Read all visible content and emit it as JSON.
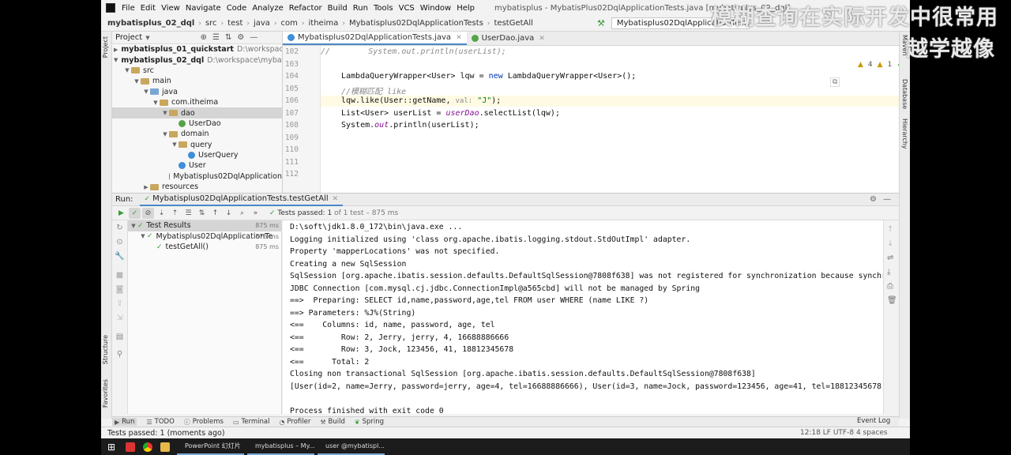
{
  "menubar": {
    "items": [
      "File",
      "Edit",
      "View",
      "Navigate",
      "Code",
      "Analyze",
      "Refactor",
      "Build",
      "Run",
      "Tools",
      "VCS",
      "Window",
      "Help"
    ],
    "window_title": "mybatisplus - MybatisPlus02DqlApplicationTests.java [mybatisplus_02_dql]"
  },
  "breadcrumb": {
    "items": [
      "mybatisplus_02_dql",
      "src",
      "test",
      "java",
      "com",
      "itheima",
      "Mybatisplus02DqlApplicationTests",
      "testGetAll"
    ],
    "run_config": "Mybatisplus02DqlApplicationTests.testGetAll"
  },
  "project_panel": {
    "title": "Project",
    "tree": [
      {
        "label": "mybatisplus_01_quickstart",
        "path": "D:\\workspace\\m",
        "bold": true,
        "kind": "module"
      },
      {
        "label": "mybatisplus_02_dql",
        "path": "D:\\workspace\\mybatisp",
        "bold": true,
        "kind": "module"
      },
      {
        "label": "src",
        "kind": "folder"
      },
      {
        "label": "main",
        "kind": "folder"
      },
      {
        "label": "java",
        "kind": "folder-blue"
      },
      {
        "label": "com.itheima",
        "kind": "folder"
      },
      {
        "label": "dao",
        "kind": "folder",
        "selected": true
      },
      {
        "label": "UserDao",
        "kind": "interface"
      },
      {
        "label": "domain",
        "kind": "folder"
      },
      {
        "label": "query",
        "kind": "folder"
      },
      {
        "label": "UserQuery",
        "kind": "class"
      },
      {
        "label": "User",
        "kind": "class"
      },
      {
        "label": "Mybatisplus02DqlApplication",
        "kind": "class"
      },
      {
        "label": "resources",
        "kind": "folder"
      }
    ]
  },
  "editor": {
    "tabs": [
      {
        "label": "Mybatisplus02DqlApplicationTests.java",
        "active": true
      },
      {
        "label": "UserDao.java",
        "active": false
      }
    ],
    "line_numbers": [
      "102",
      "103",
      "104",
      "105",
      "106",
      "107",
      "108",
      "109",
      "110",
      "111",
      "112"
    ],
    "lines": {
      "l102_comment": "//        System.out.println(userList);",
      "l104_a": "LambdaQueryWrapper<User> lqw = ",
      "l104_kw": "new",
      "l104_b": " LambdaQueryWrapper<User>();",
      "l105_comment": "//模糊匹配 like",
      "l106_a": "lqw.like(User::getName, ",
      "l106_hint": "val:",
      "l106_str": " \"J\"",
      "l106_b": ");",
      "l107_a": "List<User> userList = ",
      "l107_field": "userDao",
      "l107_b": ".selectList(lqw);",
      "l108_a": "System.",
      "l108_field": "out",
      "l108_b": ".println(userList);"
    },
    "inspections": {
      "warnings": "4",
      "weak_warnings": "1",
      "ok": "1"
    }
  },
  "run_panel": {
    "label": "Run:",
    "tab": "Mybatisplus02DqlApplicationTests.testGetAll",
    "status_main": "Tests passed:",
    "status_count": "1",
    "status_rest": "of 1 test – 875 ms",
    "results": [
      {
        "label": "Test Results",
        "time": "875 ms"
      },
      {
        "label": "Mybatisplus02DqlApplicationTe",
        "time": "875 ms"
      },
      {
        "label": "testGetAll()",
        "time": "875 ms"
      }
    ],
    "console": [
      "D:\\soft\\jdk1.8.0_172\\bin\\java.exe ...",
      "Logging initialized using 'class org.apache.ibatis.logging.stdout.StdOutImpl' adapter.",
      "Property 'mapperLocations' was not specified.",
      "Creating a new SqlSession",
      "SqlSession [org.apache.ibatis.session.defaults.DefaultSqlSession@7808f638] was not registered for synchronization because synchr",
      "JDBC Connection [com.mysql.cj.jdbc.ConnectionImpl@a565cbd] will not be managed by Spring",
      "==>  Preparing: SELECT id,name,password,age,tel FROM user WHERE (name LIKE ?)",
      "==> Parameters: %J%(String)",
      "<==    Columns: id, name, password, age, tel",
      "<==        Row: 2, Jerry, jerry, 4, 16688886666",
      "<==        Row: 3, Jock, 123456, 41, 18812345678",
      "<==      Total: 2",
      "Closing non transactional SqlSession [org.apache.ibatis.session.defaults.DefaultSqlSession@7808f638]",
      "[User(id=2, name=Jerry, password=jerry, age=4, tel=16688886666), User(id=3, name=Jock, password=123456, age=41, tel=18812345678)",
      "",
      "Process finished with exit code 0"
    ]
  },
  "side_tabs": {
    "left": [
      "Project",
      "Structure",
      "Favorites"
    ],
    "right": [
      "Maven",
      "Database",
      "Hierarchy"
    ]
  },
  "bottom_tabs": [
    "Run",
    "TODO",
    "Problems",
    "Terminal",
    "Profiler",
    "Build",
    "Spring"
  ],
  "event_log": "Event Log",
  "status_bar": {
    "text": "Tests passed: 1 (moments ago)",
    "right": "12:18   LF   UTF-8   4 spaces"
  },
  "overlay": {
    "line1": "模糊查询在实际开发中很常用",
    "line2": "越学越像"
  },
  "taskbar": {
    "tasks": [
      "PowerPoint 幻灯片",
      "mybatisplus – My...",
      "user @mybatispl..."
    ]
  },
  "colors": {
    "accent": "#4a88c7",
    "pass": "#3a9b3a",
    "keyword": "#0033b3",
    "string": "#067d17"
  }
}
